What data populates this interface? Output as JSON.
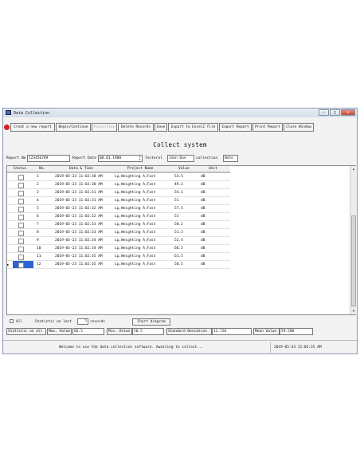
{
  "window": {
    "title": "Data Collection",
    "controls": [
      "–",
      "□",
      "✕"
    ]
  },
  "toolbar": {
    "buttons": [
      "Creat a new report",
      "Begin/Continue",
      "Pause/Stop",
      "Delete Records",
      "Save",
      "Export to Excel2 file",
      "Export Report",
      "Print Report",
      "Close Window"
    ]
  },
  "heading": "Collect system",
  "form": {
    "report_no_label": "Report No",
    "report_no_value": "123456789",
    "report_date_label": "Report Date",
    "report_date_value": "08.01.1900",
    "tester_label": "Testeral",
    "tester_value": "John Doe",
    "collection_label": "collection",
    "collection_value": "Note"
  },
  "table": {
    "headers": [
      "Status",
      "No.",
      "Data & Time",
      "Project Name",
      "Value",
      "Unit"
    ],
    "rows": [
      {
        "no": "1",
        "time": "2019-05-23 11:02:30 AM",
        "project": "Lp,Weighting A,Fast",
        "value": "53.5",
        "unit": "dB"
      },
      {
        "no": "2",
        "time": "2019-05-23 11:02:30 AM",
        "project": "Lp,Weighting A,Fast",
        "value": "49.2",
        "unit": "dB"
      },
      {
        "no": "3",
        "time": "2019-05-23 11:02:31 AM",
        "project": "Lp,Weighting A,Fast",
        "value": "54.1",
        "unit": "dB"
      },
      {
        "no": "4",
        "time": "2019-05-23 11:02:31 AM",
        "project": "Lp,Weighting A,Fast",
        "value": "51",
        "unit": "dB"
      },
      {
        "no": "5",
        "time": "2019-05-23 11:02:32 AM",
        "project": "Lp,Weighting A,Fast",
        "value": "57.5",
        "unit": "dB"
      },
      {
        "no": "6",
        "time": "2019-05-23 11:02:32 AM",
        "project": "Lp,Weighting A,Fast",
        "value": "51",
        "unit": "dB"
      },
      {
        "no": "7",
        "time": "2019-05-23 11:02:33 AM",
        "project": "Lp,Weighting A,Fast",
        "value": "50.2",
        "unit": "dB"
      },
      {
        "no": "8",
        "time": "2019-05-23 11:02:33 AM",
        "project": "Lp,Weighting A,Fast",
        "value": "51.3",
        "unit": "dB"
      },
      {
        "no": "9",
        "time": "2019-05-23 11:02:34 AM",
        "project": "Lp,Weighting A,Fast",
        "value": "52.4",
        "unit": "dB"
      },
      {
        "no": "10",
        "time": "2019-05-23 11:02:34 AM",
        "project": "Lp,Weighting A,Fast",
        "value": "66.5",
        "unit": "dB"
      },
      {
        "no": "11",
        "time": "2019-05-23 11:02:35 AM",
        "project": "Lp,Weighting A,Fast",
        "value": "61.5",
        "unit": "dB"
      },
      {
        "no": "12",
        "time": "2019-05-23 11:02:35 AM",
        "project": "Lp,Weighting A,Fast",
        "value": "50.5",
        "unit": "dB"
      }
    ]
  },
  "bottom": {
    "all_label": "All",
    "statistic_last_label": "Statistic on last",
    "statistic_last_value": "5",
    "records_label": "records",
    "chart_button": "Chart diagram",
    "statistic_all_label": "Statistic on all",
    "max_label": "Max. Value",
    "max_value": "66.5",
    "min_label": "Min. Value",
    "min_value": "50.5",
    "std_label": "Standard Deviation",
    "std_value": "12.726",
    "mean_label": "Mean Value",
    "mean_value": "59.580"
  },
  "status": {
    "message": "Welcome to use the data collection software. Awaiting to collect...",
    "datetime": "2019-05-23 11:02:35 AM"
  },
  "colors": {
    "accent": "#2d64cf",
    "record": "#d61f1f"
  }
}
